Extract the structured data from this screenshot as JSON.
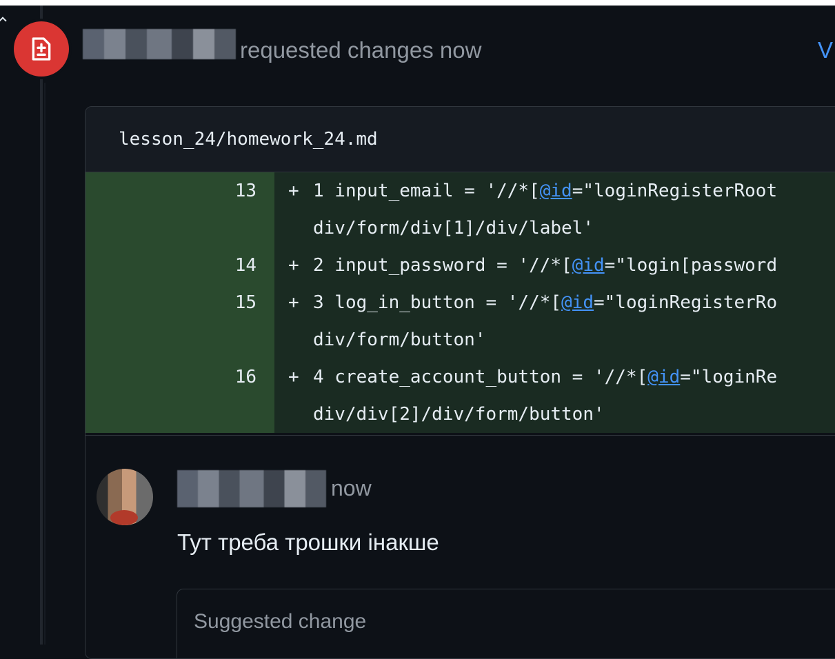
{
  "review": {
    "action_text": "requested changes now",
    "view_link_label": "V",
    "badge_icon": "file-diff-icon"
  },
  "file": {
    "path": "lesson_24/homework_24.md"
  },
  "diff_lines": [
    {
      "line": "13",
      "marker": "+",
      "text": "1 input_email = '//*[",
      "at": "@id",
      "rest": "=\"loginRegisterRoot",
      "cont": "div/form/div[1]/div/label'"
    },
    {
      "line": "14",
      "marker": "+",
      "text": "2 input_password = '//*[",
      "at": "@id",
      "rest": "=\"login[password",
      "cont": ""
    },
    {
      "line": "15",
      "marker": "+",
      "text": "3 log_in_button = '//*[",
      "at": "@id",
      "rest": "=\"loginRegisterRo",
      "cont": "div/form/button'"
    },
    {
      "line": "16",
      "marker": "+",
      "text": "4 create_account_button = '//*[",
      "at": "@id",
      "rest": "=\"loginRe",
      "cont": "div/div[2]/div/form/button'"
    }
  ],
  "comment": {
    "time": "now",
    "body": "Тут треба трошки інакше",
    "suggestion_title": "Suggested change"
  }
}
